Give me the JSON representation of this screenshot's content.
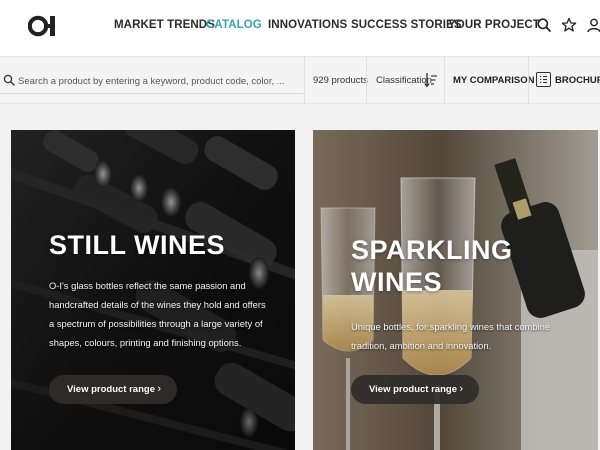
{
  "brand": {
    "logo_text": "O-I"
  },
  "nav": {
    "items": [
      {
        "label": "MARKET TRENDS",
        "active": false
      },
      {
        "label": "CATALOG",
        "active": true
      },
      {
        "label": "INNOVATIONS",
        "active": false
      },
      {
        "label": "SUCCESS STORIES",
        "active": false
      },
      {
        "label": "YOUR PROJECT",
        "active": false
      }
    ],
    "icons": [
      "search-icon",
      "star-icon",
      "user-icon"
    ],
    "active_color": "#3aa6a0"
  },
  "toolbar": {
    "search_placeholder": "Search a product by entering a keyword, product code, color, ...",
    "product_count": "929 products",
    "classification_label": "Classification",
    "comparison_label": "MY COMPARISON",
    "brochure_label": "BROCHURE"
  },
  "cards": [
    {
      "title_line1": "STILL WINES",
      "title_line2": "",
      "description": "O-I's glass bottles reflect the same passion and handcrafted details of the wines they hold and offers a spectrum of possibilities through a large variety of shapes, colours, printing and finishing options.",
      "button_label": "View product range"
    },
    {
      "title_line1": "SPARKLING",
      "title_line2": "WINES",
      "description": "Unique bottles, for sparkling wines that combine tradition, ambition and innovation.",
      "button_label": "View product range"
    }
  ]
}
